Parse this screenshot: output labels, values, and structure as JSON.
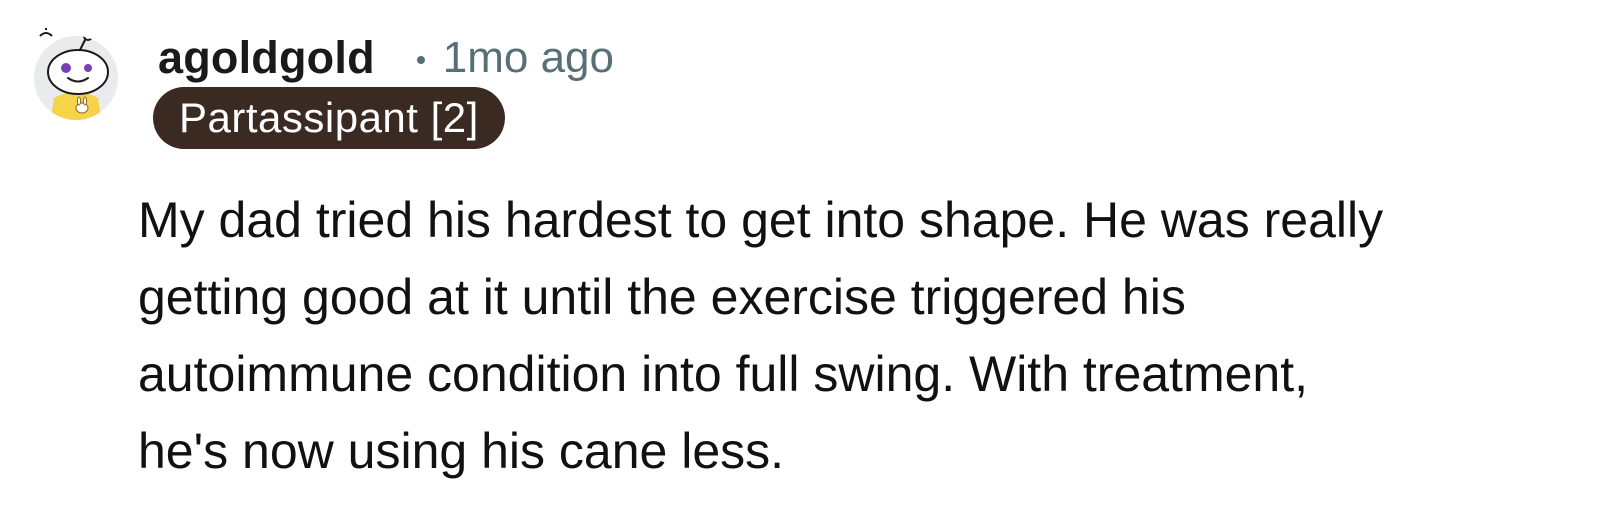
{
  "comment": {
    "author": "agoldgold",
    "separator": "•",
    "time_ago": "1mo ago",
    "flair": "Partassipant [2]",
    "lines": [
      "My dad tried his hardest to get into shape. He was really",
      "getting good at it until the exercise triggered his",
      "autoimmune condition into full swing. With treatment,",
      "he's now using his cane less."
    ],
    "avatar_icon": "snoo-avatar-icon",
    "colors": {
      "flair_background": "#3a2a22",
      "flair_text": "#ffffff",
      "meta_text": "#576f76",
      "body_text": "#111111"
    }
  }
}
